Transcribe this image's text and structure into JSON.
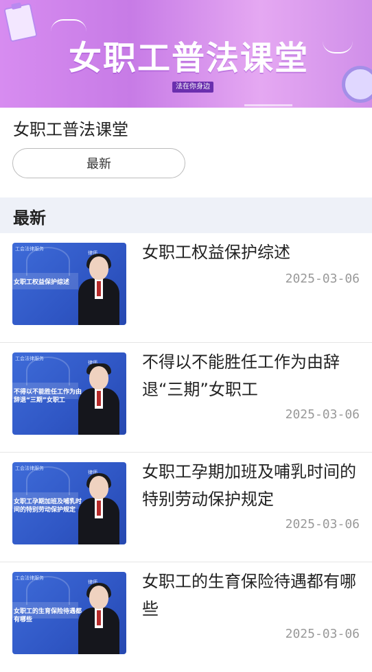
{
  "banner": {
    "title": "女职工普法课堂",
    "subtitle": "法在你身边"
  },
  "header": {
    "title": "女职工普法课堂",
    "filter_label": "最新"
  },
  "section": {
    "label": "最新"
  },
  "items": [
    {
      "title": "女职工权益保护综述",
      "date": "2025-03-06",
      "thumb_caption": "女职工权益保护综述",
      "thumb_badge": "工会法律服务",
      "thumb_name": "律师"
    },
    {
      "title": "不得以不能胜任工作为由辞退“三期”女职工",
      "date": "2025-03-06",
      "thumb_caption": "不得以不能胜任工作为由辞退“三期”女职工",
      "thumb_badge": "工会法律服务",
      "thumb_name": "律师"
    },
    {
      "title": "女职工孕期加班及哺乳时间的特别劳动保护规定",
      "date": "2025-03-06",
      "thumb_caption": "女职工孕期加班及哺乳时间的特别劳动保护规定",
      "thumb_badge": "工会法律服务",
      "thumb_name": "律师"
    },
    {
      "title": "女职工的生育保险待遇都有哪些",
      "date": "2025-03-06",
      "thumb_caption": "女职工的生育保险待遇都有哪些",
      "thumb_badge": "工会法律服务",
      "thumb_name": "律师"
    }
  ]
}
